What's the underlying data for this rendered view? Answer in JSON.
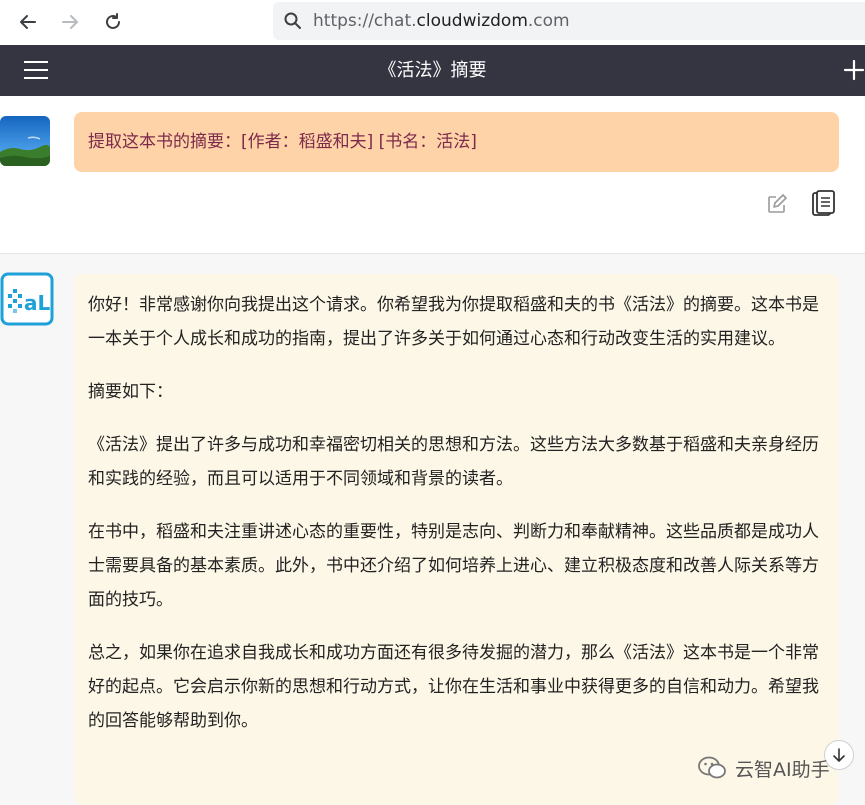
{
  "browser": {
    "url_scheme": "https://chat.",
    "url_domain": "cloudwizdom",
    "url_tld": ".com"
  },
  "header": {
    "title": "《活法》摘要"
  },
  "user_message": {
    "text": "提取这本书的摘要：[作者：稻盛和夫] [书名：活法]"
  },
  "ai_message": {
    "paragraphs": [
      "你好！非常感谢你向我提出这个请求。你希望我为你提取稻盛和夫的书《活法》的摘要。这本书是一本关于个人成长和成功的指南，提出了许多关于如何通过心态和行动改变生活的实用建议。",
      "摘要如下：",
      "《活法》提出了许多与成功和幸福密切相关的思想和方法。这些方法大多数基于稻盛和夫亲身经历和实践的经验，而且可以适用于不同领域和背景的读者。",
      "在书中，稻盛和夫注重讲述心态的重要性，特别是志向、判断力和奉献精神。这些品质都是成功人士需要具备的基本素质。此外，书中还介绍了如何培养上进心、建立积极态度和改善人际关系等方面的技巧。",
      "总之，如果你在追求自我成长和成功方面还有很多待发掘的潜力，那么《活法》这本书是一个非常好的起点。它会启示你新的思想和行动方式，让你在生活和事业中获得更多的自信和动力。希望我的回答能够帮助到你。"
    ]
  },
  "watermark": {
    "text": "云智AI助手"
  },
  "icons": {
    "back": "arrow-left-icon",
    "forward": "arrow-right-icon",
    "reload": "reload-icon",
    "search": "search-icon",
    "menu": "hamburger-menu-icon",
    "new_chat": "plus-icon",
    "edit": "edit-icon",
    "copy": "copy-icon",
    "scroll": "arrow-down-icon",
    "wechat": "wechat-icon"
  },
  "colors": {
    "header_bg": "#343541",
    "user_bubble": "#ffd3a8",
    "user_text": "#7c2a4a",
    "ai_bubble": "#fdf7e7",
    "ai_section_bg": "#f7f7f8",
    "ai_logo": "#1da1d8"
  }
}
